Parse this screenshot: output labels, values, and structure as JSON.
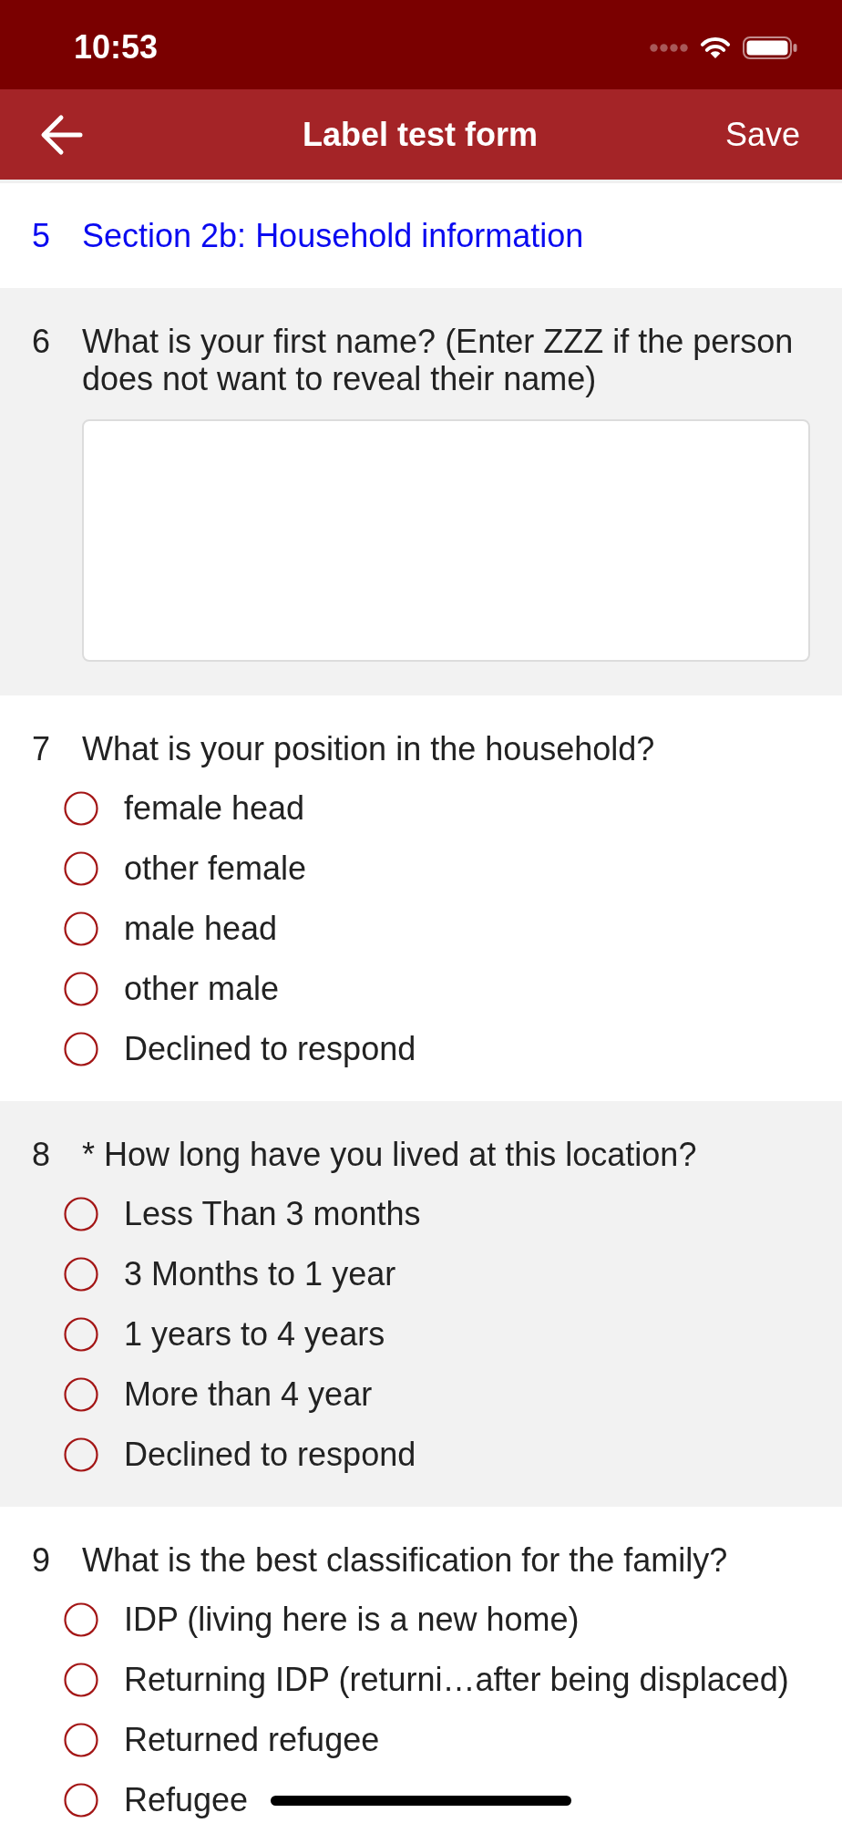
{
  "status_bar": {
    "time": "10:53"
  },
  "nav_bar": {
    "title": "Label test form",
    "action": "Save"
  },
  "form": {
    "items": [
      {
        "kind": "section",
        "number": "5",
        "title": "Section 2b: Household information"
      },
      {
        "kind": "text",
        "number": "6",
        "question": "What is your first name? (Enter ZZZ if the person does not want to reveal their name)"
      },
      {
        "kind": "select_one",
        "number": "7",
        "question": "What is your position in the household?",
        "options": [
          {
            "label": "female head",
            "selected": false
          },
          {
            "label": "other female",
            "selected": false
          },
          {
            "label": "male head",
            "selected": false
          },
          {
            "label": "other male",
            "selected": false
          },
          {
            "label": "Declined to respond",
            "selected": false
          }
        ]
      },
      {
        "kind": "select_one",
        "number": "8",
        "question": "* How long have you lived at this location?",
        "options": [
          {
            "label": "Less Than 3 months",
            "selected": false
          },
          {
            "label": "3 Months to 1 year",
            "selected": false
          },
          {
            "label": "1 years to 4 years",
            "selected": false
          },
          {
            "label": "More than 4 year",
            "selected": false
          },
          {
            "label": "Declined to respond",
            "selected": false
          }
        ]
      },
      {
        "kind": "select_one",
        "number": "9",
        "question": "What is the best classification for the family?",
        "options": [
          {
            "label": "IDP (living here is a new home)",
            "selected": false
          },
          {
            "label": "Returning IDP (returni…after being displaced)",
            "selected": false
          },
          {
            "label": "Returned refugee",
            "selected": false
          },
          {
            "label": "Refugee",
            "selected": false
          }
        ]
      }
    ]
  }
}
